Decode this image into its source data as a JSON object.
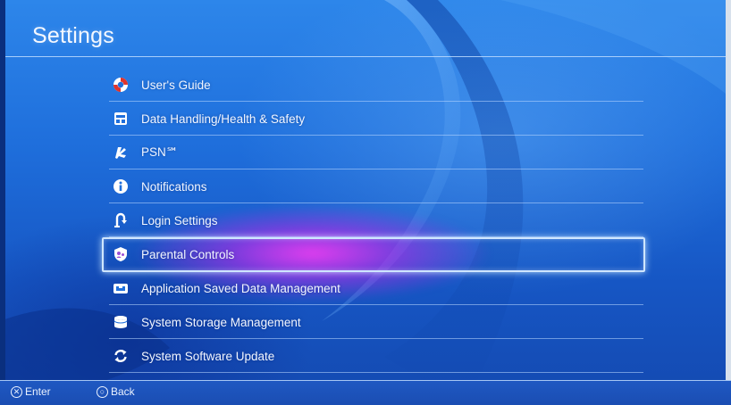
{
  "header": {
    "title": "Settings"
  },
  "menu": {
    "items": [
      {
        "label": "User's Guide",
        "icon": "lifebuoy-icon"
      },
      {
        "label": "Data Handling/Health & Safety",
        "icon": "document-icon"
      },
      {
        "label": "PSN℠",
        "icon": "psn-logo-icon"
      },
      {
        "label": "Notifications",
        "icon": "info-icon"
      },
      {
        "label": "Login Settings",
        "icon": "login-icon"
      },
      {
        "label": "Parental Controls",
        "icon": "parental-controls-icon",
        "selected": true
      },
      {
        "label": "Application Saved Data Management",
        "icon": "gamepad-icon"
      },
      {
        "label": "System Storage Management",
        "icon": "storage-icon"
      },
      {
        "label": "System Software Update",
        "icon": "update-icon"
      }
    ]
  },
  "footer": {
    "enter_label": "Enter",
    "enter_glyph": "✕",
    "back_label": "Back",
    "back_glyph": "○"
  },
  "colors": {
    "background": "#1f6fdc",
    "selection_glow": "#e03cf0",
    "text": "#ffffff"
  }
}
